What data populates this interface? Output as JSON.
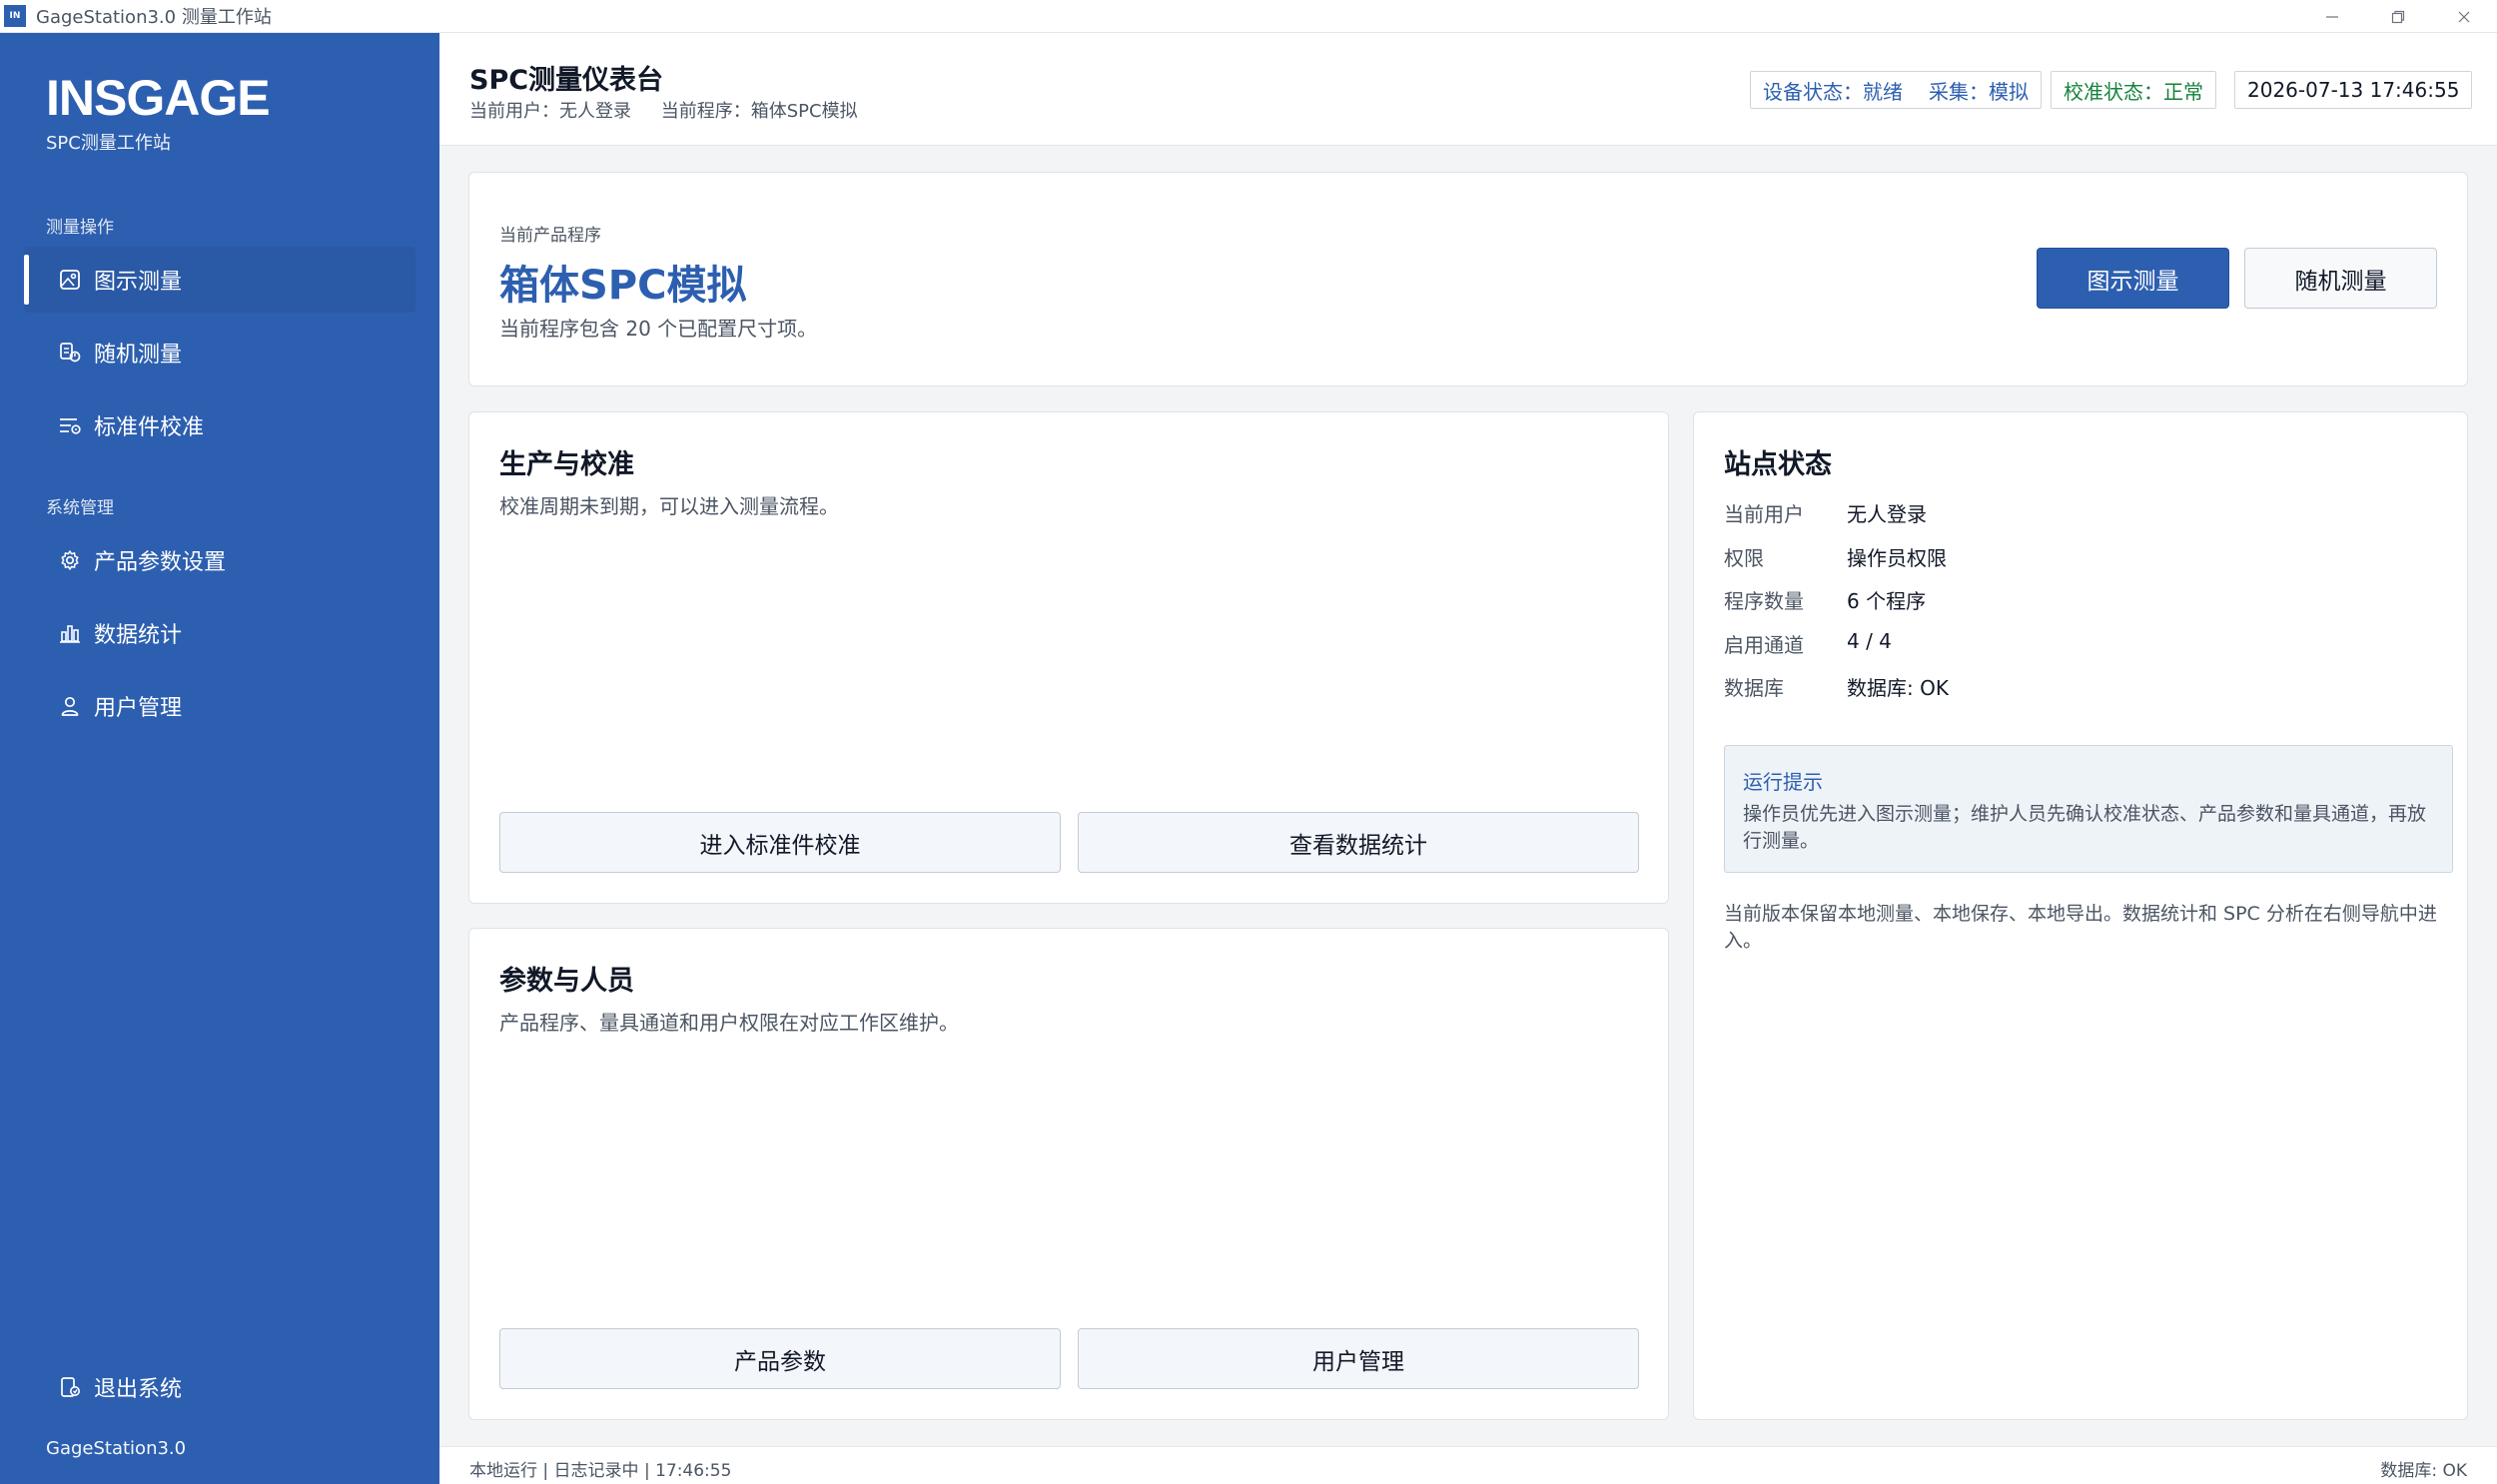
{
  "window": {
    "logo_text": "IN",
    "title": "GageStation3.0 测量工作站"
  },
  "sidebar": {
    "brand": "INSGAGE",
    "brand_sub": "SPC测量工作站",
    "section_measure": "测量操作",
    "section_system": "系统管理",
    "items": [
      {
        "label": "图示测量",
        "icon": "image-icon",
        "active": true
      },
      {
        "label": "随机测量",
        "icon": "random-measure-icon",
        "active": false
      },
      {
        "label": "标准件校准",
        "icon": "calibration-icon",
        "active": false
      },
      {
        "label": "产品参数设置",
        "icon": "gear-icon",
        "active": false
      },
      {
        "label": "数据统计",
        "icon": "bar-chart-icon",
        "active": false
      },
      {
        "label": "用户管理",
        "icon": "user-icon",
        "active": false
      }
    ],
    "logout": "退出系统",
    "version": "GageStation3.0"
  },
  "header": {
    "title": "SPC测量仪表台",
    "current_user": "当前用户：无人登录",
    "current_program": "当前程序：箱体SPC模拟",
    "device_status": "设备状态：就绪",
    "acquisition": "采集：模拟",
    "calibration_status": "校准状态：正常",
    "datetime": "2026-07-13 17:46:55",
    "colors": {
      "info": "#2d5fb0",
      "ok": "#16823e"
    }
  },
  "program_card": {
    "label": "当前产品程序",
    "name": "箱体SPC模拟",
    "desc": "当前程序包含 20 个已配置尺寸项。",
    "btn_graphic": "图示测量",
    "btn_random": "随机测量"
  },
  "production_card": {
    "title": "生产与校准",
    "desc": "校准周期未到期，可以进入测量流程。",
    "btn_calibration": "进入标准件校准",
    "btn_stats": "查看数据统计"
  },
  "params_card": {
    "title": "参数与人员",
    "desc": "产品程序、量具通道和用户权限在对应工作区维护。",
    "btn_params": "产品参数",
    "btn_users": "用户管理"
  },
  "station_card": {
    "title": "站点状态",
    "rows": [
      {
        "key": "当前用户",
        "value": "无人登录"
      },
      {
        "key": "权限",
        "value": "操作员权限"
      },
      {
        "key": "程序数量",
        "value": "6 个程序"
      },
      {
        "key": "启用通道",
        "value": "4 / 4"
      },
      {
        "key": "数据库",
        "value": "数据库: OK"
      }
    ],
    "tip_title": "运行提示",
    "tip_text": "操作员优先进入图示测量；维护人员先确认校准状态、产品参数和量具通道，再放行测量。",
    "footnote": "当前版本保留本地测量、本地保存、本地导出。数据统计和 SPC 分析在右侧导航中进入。"
  },
  "statusbar": {
    "left": "本地运行 | 日志记录中 | 17:46:55",
    "right": "数据库: OK"
  }
}
